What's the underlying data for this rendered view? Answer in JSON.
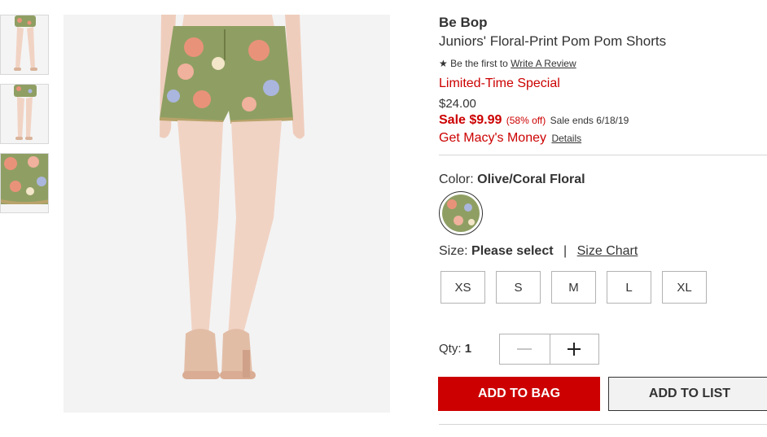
{
  "product": {
    "brand": "Be Bop",
    "title": "Juniors' Floral-Print Pom Pom Shorts",
    "review_prefix": "Be the first to",
    "review_link": "Write A Review",
    "special": "Limited-Time Special",
    "original_price": "$24.00",
    "sale_price": "Sale $9.99",
    "percent_off": "(58% off)",
    "sale_ends": "Sale ends 6/18/19",
    "macys_money": "Get Macy's Money",
    "details_link": "Details"
  },
  "color": {
    "label": "Color:",
    "value": "Olive/Coral Floral"
  },
  "size": {
    "label": "Size:",
    "value": "Please select",
    "separator": "|",
    "chart_link": "Size Chart",
    "options": [
      "XS",
      "S",
      "M",
      "L",
      "XL"
    ]
  },
  "quantity": {
    "label": "Qty:",
    "value": "1"
  },
  "actions": {
    "add_to_bag": "ADD TO BAG",
    "add_to_list": "ADD TO LIST"
  },
  "colors": {
    "accent": "#cc0000",
    "fabric": "#8f9f63",
    "skin": "#f1d3c4"
  },
  "icons": {
    "star": "star-icon",
    "minus": "minus-icon",
    "plus": "plus-icon"
  }
}
